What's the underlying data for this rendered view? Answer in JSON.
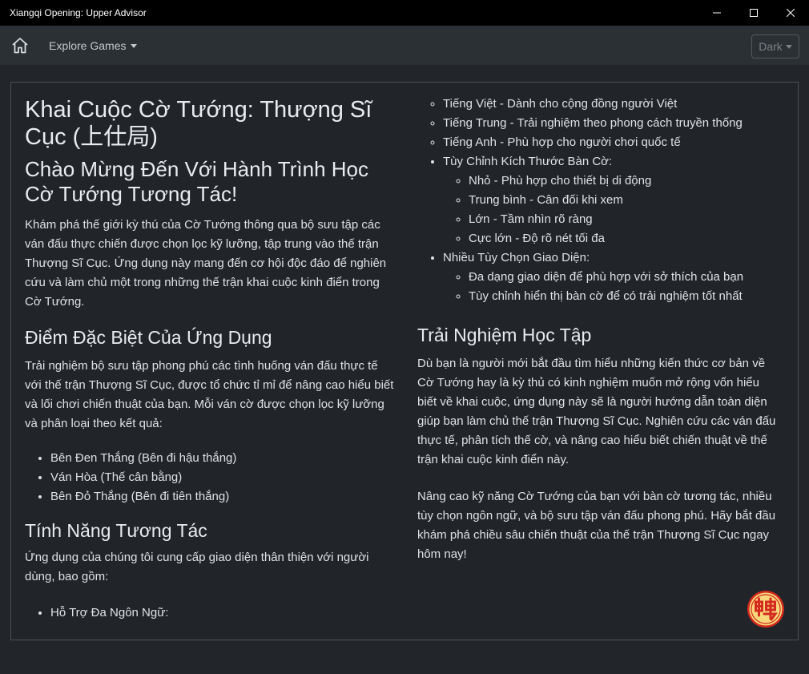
{
  "window": {
    "title": "Xiangqi Opening: Upper Advisor"
  },
  "navbar": {
    "explore_label": "Explore Games",
    "theme_label": "Dark"
  },
  "content": {
    "title": "Khai Cuộc Cờ Tướng: Thượng Sĩ Cục (上仕局)",
    "welcome_heading": "Chào Mừng Đến Với Hành Trình Học Cờ Tướng Tương Tác!",
    "intro": "Khám phá thế giới kỳ thú của Cờ Tướng thông qua bộ sưu tập các ván đấu thực chiến được chọn lọc kỹ lưỡng, tập trung vào thế trận Thượng Sĩ Cục. Ứng dụng này mang đến cơ hội độc đáo để nghiên cứu và làm chủ một trong những thế trận khai cuộc kinh điển trong Cờ Tướng.",
    "special_heading": "Điểm Đặc Biệt Của Ứng Dụng",
    "special_text": "Trải nghiệm bộ sưu tập phong phú các tình huống ván đấu thực tế với thế trận Thượng Sĩ Cục, được tổ chức tỉ mỉ để nâng cao hiểu biết và lối chơi chiến thuật của bạn. Mỗi ván cờ được chọn lọc kỹ lưỡng và phân loại theo kết quả:",
    "results": [
      "Bên Đen Thắng (Bên đi hậu thắng)",
      "Ván Hòa (Thế cân bằng)",
      "Bên Đỏ Thắng (Bên đi tiên thắng)"
    ],
    "interactive_heading": "Tính Năng Tương Tác",
    "interactive_text": "Ứng dụng của chúng tôi cung cấp giao diện thân thiện với người dùng, bao gồm:",
    "features": {
      "language": {
        "label": "Hỗ Trợ Đa Ngôn Ngữ:",
        "items": [
          "Tiếng Việt - Dành cho cộng đồng người Việt",
          "Tiếng Trung - Trải nghiệm theo phong cách truyền thống",
          "Tiếng Anh - Phù hợp cho người chơi quốc tế"
        ]
      },
      "board_size": {
        "label": "Tùy Chỉnh Kích Thước Bàn Cờ:",
        "items": [
          "Nhỏ - Phù hợp cho thiết bị di động",
          "Trung bình - Cân đối khi xem",
          "Lớn - Tầm nhìn rõ ràng",
          "Cực lớn - Độ rõ nét tối đa"
        ]
      },
      "themes": {
        "label": "Nhiều Tùy Chọn Giao Diện:",
        "items": [
          "Đa dạng giao diện để phù hợp với sở thích của bạn",
          "Tùy chỉnh hiển thị bàn cờ để có trải nghiệm tốt nhất"
        ]
      }
    },
    "learning_heading": "Trải Nghiệm Học Tập",
    "learning_text_1": "Dù bạn là người mới bắt đầu tìm hiểu những kiến thức cơ bản về Cờ Tướng hay là kỳ thủ có kinh nghiệm muốn mở rộng vốn hiểu biết về khai cuộc, ứng dụng này sẽ là người hướng dẫn toàn diện giúp bạn làm chủ thế trận Thượng Sĩ Cục. Nghiên cứu các ván đấu thực tế, phân tích thế cờ, và nâng cao hiểu biết chiến thuật về thế trận khai cuộc kinh điển này.",
    "learning_text_2": "Nâng cao kỹ năng Cờ Tướng của bạn với bàn cờ tương tác, nhiều tùy chọn ngôn ngữ, và bộ sưu tập ván đấu phong phú. Hãy bắt đầu khám phá chiều sâu chiến thuật của thế trận Thượng Sĩ Cục ngay hôm nay!"
  },
  "colors": {
    "background": "#222529",
    "navbar": "#2b3035",
    "logo_fill": "#f7d97c",
    "logo_red": "#d42a1f"
  },
  "icons": {
    "home": "home-icon",
    "minimize": "minimize-icon",
    "maximize": "maximize-icon",
    "close": "close-icon",
    "logo": "xiangqi-piece-logo"
  }
}
